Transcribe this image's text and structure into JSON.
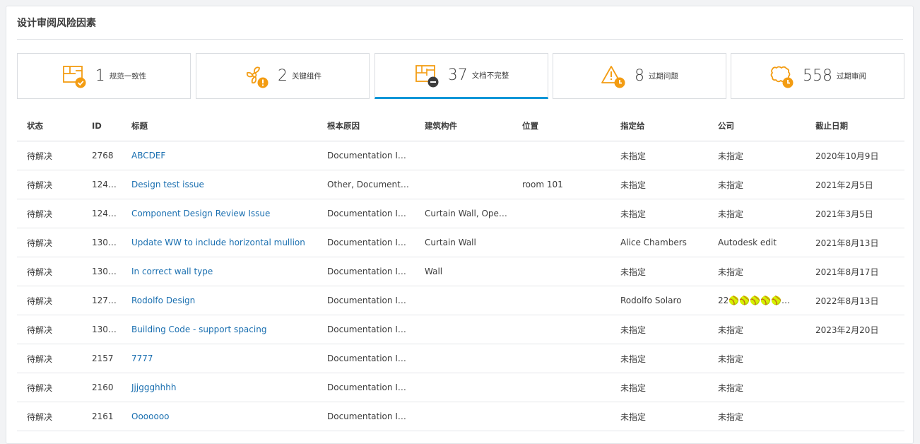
{
  "panel": {
    "title": "设计审阅风险因素"
  },
  "cards": [
    {
      "count": "1",
      "label": "规范一致性",
      "icon": "floorplan-check-icon"
    },
    {
      "count": "2",
      "label": "关键组件",
      "icon": "fan-warning-icon"
    },
    {
      "count": "37",
      "label": "文档不完整",
      "icon": "blueprint-minus-icon"
    },
    {
      "count": "8",
      "label": "过期问题",
      "icon": "warning-clock-icon"
    },
    {
      "count": "558",
      "label": "过期审阅",
      "icon": "cloud-clock-icon"
    }
  ],
  "colors": {
    "accent": "#0696d7",
    "orange": "#f39c12",
    "overdue": "#e8384f",
    "link": "#1a6fb0"
  },
  "table": {
    "headers": [
      "状态",
      "ID",
      "标题",
      "根本原因",
      "建筑构件",
      "位置",
      "指定给",
      "公司",
      "截止日期"
    ],
    "rows": [
      {
        "status": "待解决",
        "id": "2768",
        "title": "ABCDEF",
        "cause": "Documentation I…",
        "component": "",
        "location": "",
        "assignee": "未指定",
        "company": "未指定",
        "due": "2020年10月9日"
      },
      {
        "status": "待解决",
        "id": "124…",
        "title": "Design test issue",
        "cause": "Other, Document…",
        "component": "",
        "location": "room 101",
        "assignee": "未指定",
        "company": "未指定",
        "due": "2021年2月5日"
      },
      {
        "status": "待解决",
        "id": "124…",
        "title": "Component Design Review Issue",
        "cause": "Documentation I…",
        "component": "Curtain Wall, Ope…",
        "location": "",
        "assignee": "未指定",
        "company": "未指定",
        "due": "2021年3月5日"
      },
      {
        "status": "待解决",
        "id": "130…",
        "title": "Update WW to include horizontal mullion",
        "cause": "Documentation I…",
        "component": "Curtain Wall",
        "location": "",
        "assignee": "Alice Chambers",
        "company": "Autodesk edit",
        "due": "2021年8月13日"
      },
      {
        "status": "待解决",
        "id": "130…",
        "title": "In correct wall type",
        "cause": "Documentation I…",
        "component": "Wall",
        "location": "",
        "assignee": "未指定",
        "company": "未指定",
        "due": "2021年8月17日"
      },
      {
        "status": "待解决",
        "id": "127…",
        "title": "Rodolfo Design",
        "cause": "Documentation I…",
        "component": "",
        "location": "",
        "assignee": "Rodolfo Solaro",
        "company": "22🥎🥎🥎🥎🥎…",
        "due": "2022年8月13日"
      },
      {
        "status": "待解决",
        "id": "130…",
        "title": "Building Code - support spacing",
        "cause": "Documentation I…",
        "component": "",
        "location": "",
        "assignee": "未指定",
        "company": "未指定",
        "due": "2023年2月20日"
      },
      {
        "status": "待解决",
        "id": "2157",
        "title": "7777",
        "cause": "Documentation I…",
        "component": "",
        "location": "",
        "assignee": "未指定",
        "company": "未指定",
        "due": ""
      },
      {
        "status": "待解决",
        "id": "2160",
        "title": "Jjjggghhhh",
        "cause": "Documentation I…",
        "component": "",
        "location": "",
        "assignee": "未指定",
        "company": "未指定",
        "due": ""
      },
      {
        "status": "待解决",
        "id": "2161",
        "title": "Ooooooo",
        "cause": "Documentation I…",
        "component": "",
        "location": "",
        "assignee": "未指定",
        "company": "未指定",
        "due": ""
      }
    ]
  }
}
